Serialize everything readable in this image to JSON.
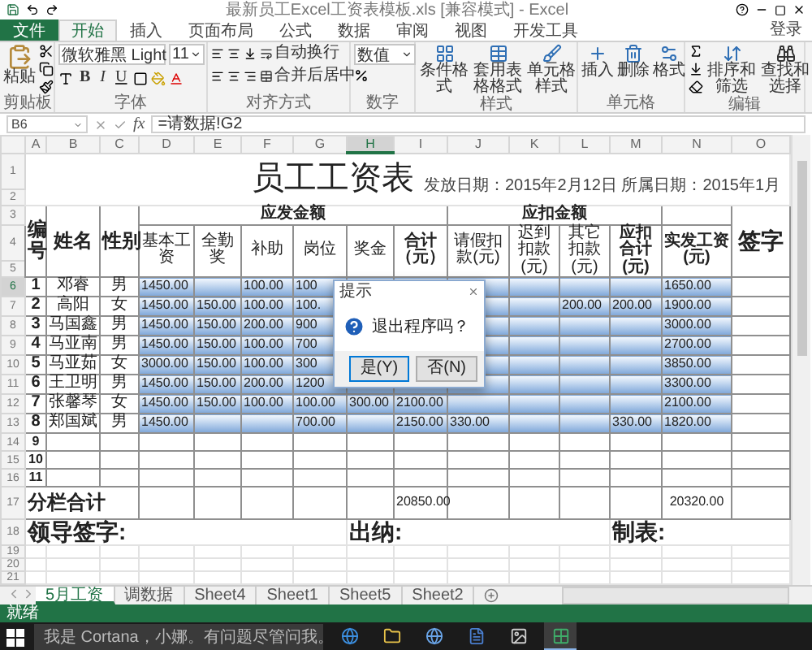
{
  "window": {
    "title": "最新员工Excel工资表模板.xls [兼容模式] - Excel"
  },
  "ribbon_tabs": [
    {
      "label": "文件",
      "kind": "file",
      "selected": false
    },
    {
      "label": "开始",
      "kind": "tab",
      "selected": true
    },
    {
      "label": "插入",
      "kind": "tab",
      "selected": false
    },
    {
      "label": "页面布局",
      "kind": "tab",
      "selected": false
    },
    {
      "label": "公式",
      "kind": "tab",
      "selected": false
    },
    {
      "label": "数据",
      "kind": "tab",
      "selected": false
    },
    {
      "label": "审阅",
      "kind": "tab",
      "selected": false
    },
    {
      "label": "视图",
      "kind": "tab",
      "selected": false
    },
    {
      "label": "开发工具",
      "kind": "tab",
      "selected": false
    }
  ],
  "account": "登录",
  "ribbon": {
    "groups": [
      {
        "label": "剪贴板",
        "kind": "clipboard",
        "buttons": [
          "粘贴"
        ]
      },
      {
        "label": "字体",
        "kind": "font",
        "font_name": "微软雅黑 Light",
        "font_size": "11",
        "buttons": [
          "B",
          "I",
          "U"
        ]
      },
      {
        "label": "对齐方式",
        "kind": "alignment",
        "buttons": [
          "自动换行",
          "合并后居中"
        ]
      },
      {
        "label": "数字",
        "kind": "number",
        "format": "数值"
      },
      {
        "label": "样式",
        "kind": "styles",
        "buttons": [
          "条件格式",
          "套用表格格式",
          "单元格样式"
        ]
      },
      {
        "label": "单元格",
        "kind": "cells",
        "buttons": [
          "插入",
          "删除",
          "格式"
        ]
      },
      {
        "label": "编辑",
        "kind": "editing",
        "buttons": [
          "排序和筛选",
          "查找和选择"
        ]
      }
    ]
  },
  "formula_bar": {
    "name_box": "B6",
    "function_button": "fx",
    "formula": "=请数据!G2"
  },
  "columns": [
    {
      "label": "A",
      "selected": false
    },
    {
      "label": "B",
      "selected": false
    },
    {
      "label": "C",
      "selected": false
    },
    {
      "label": "D",
      "selected": false
    },
    {
      "label": "E",
      "selected": false
    },
    {
      "label": "F",
      "selected": false
    },
    {
      "label": "G",
      "selected": false
    },
    {
      "label": "H",
      "selected": true
    },
    {
      "label": "I",
      "selected": false
    },
    {
      "label": "J",
      "selected": false
    },
    {
      "label": "K",
      "selected": false
    },
    {
      "label": "L",
      "selected": false
    },
    {
      "label": "M",
      "selected": false
    },
    {
      "label": "N",
      "selected": false
    },
    {
      "label": "O",
      "selected": false
    }
  ],
  "title_rows": [
    "1",
    "2"
  ],
  "title": "员工工资表",
  "dates": "发放日期：2015年2月12日 所属日期：2015年1月",
  "header": {
    "rows": [
      "3",
      "4",
      "5"
    ],
    "number": "编号",
    "name": "姓名",
    "gender": "性别",
    "earnings": "应发金额",
    "deductions": "应扣金额",
    "earning_columns": [
      "基本工资",
      "全勤奖",
      "补助",
      "岗位",
      "奖金",
      "合计（元）"
    ],
    "deduction_columns": [
      "请假扣款(元)",
      "迟到扣款(元)",
      "其它扣款(元)",
      "应扣合计(元)"
    ],
    "net_pay": "实发工资(元)",
    "signature": "签字"
  },
  "employees": [
    {
      "row": "6",
      "selected": true,
      "no": "1",
      "name": "邓睿",
      "gender": "男",
      "values": {
        "D": "1450.00",
        "F": "100.00",
        "G": "100",
        "N": "1650.00"
      }
    },
    {
      "row": "7",
      "selected": false,
      "no": "2",
      "name": "高阳",
      "gender": "女",
      "values": {
        "D": "1450.00",
        "E": "150.00",
        "F": "100.00",
        "G": "100.",
        "L": "200.00",
        "M": "200.00",
        "N": "1900.00"
      }
    },
    {
      "row": "8",
      "selected": false,
      "no": "3",
      "name": "马国鑫",
      "gender": "男",
      "values": {
        "D": "1450.00",
        "E": "150.00",
        "F": "200.00",
        "G": "900",
        "N": "3000.00"
      }
    },
    {
      "row": "9",
      "selected": false,
      "no": "4",
      "name": "马亚南",
      "gender": "男",
      "values": {
        "D": "1450.00",
        "E": "150.00",
        "F": "100.00",
        "G": "700",
        "N": "2700.00"
      }
    },
    {
      "row": "10",
      "selected": false,
      "no": "5",
      "name": "马亚茹",
      "gender": "女",
      "values": {
        "D": "3000.00",
        "E": "150.00",
        "F": "100.00",
        "G": "300",
        "N": "3850.00"
      }
    },
    {
      "row": "11",
      "selected": false,
      "no": "6",
      "name": "王卫明",
      "gender": "男",
      "values": {
        "D": "1450.00",
        "E": "150.00",
        "F": "200.00",
        "G": "1200",
        "N": "3300.00"
      }
    },
    {
      "row": "12",
      "selected": false,
      "no": "7",
      "name": "张馨琴",
      "gender": "女",
      "values": {
        "D": "1450.00",
        "E": "150.00",
        "F": "100.00",
        "G": "100.00",
        "H": "300.00",
        "I": "2100.00",
        "N": "2100.00"
      }
    },
    {
      "row": "13",
      "selected": false,
      "no": "8",
      "name": "郑国斌",
      "gender": "男",
      "values": {
        "D": "1450.00",
        "G": "700.00",
        "I": "2150.00",
        "J": "330.00",
        "M": "330.00",
        "N": "1820.00"
      }
    }
  ],
  "blank_rows": [
    {
      "row": "14",
      "no": "9"
    },
    {
      "row": "15",
      "no": "10"
    },
    {
      "row": "16",
      "no": "11"
    }
  ],
  "totals": {
    "row": "17",
    "label": "分栏合计",
    "total": "20850.00",
    "net_total": "20320.00"
  },
  "signatures": {
    "row": "18",
    "items": [
      "领导签字:",
      "出纳:",
      "制表:"
    ]
  },
  "extra_rows": [
    "19",
    "20",
    "21"
  ],
  "sheet_tabs": [
    {
      "label": "5月工资",
      "selected": true
    },
    {
      "label": "调数据",
      "selected": false
    },
    {
      "label": "Sheet4",
      "selected": false
    },
    {
      "label": "Sheet1",
      "selected": false
    },
    {
      "label": "Sheet5",
      "selected": false
    },
    {
      "label": "Sheet2",
      "selected": false
    }
  ],
  "status_bar": {
    "text": "就绪"
  },
  "taskbar": {
    "search_placeholder": "我是 Cortana，小娜。有问题尽管问我。"
  },
  "dialog": {
    "title": "提示",
    "message": "退出程序吗？",
    "buttons": [
      "是(Y)",
      "否(N)"
    ]
  }
}
